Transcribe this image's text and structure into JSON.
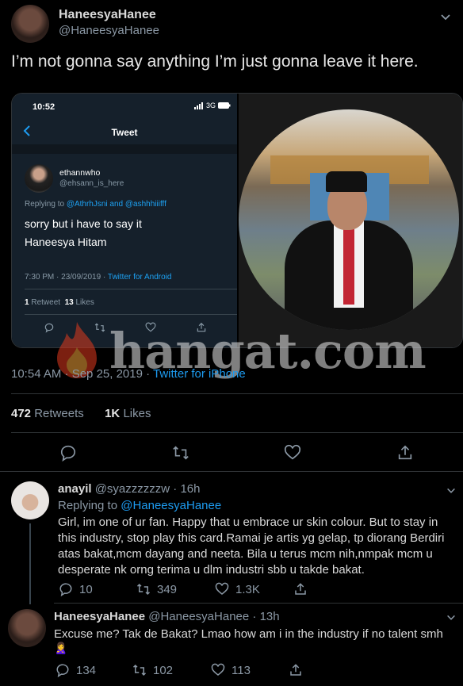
{
  "main_tweet": {
    "display_name": "HaneesyaHanee",
    "handle": "@HaneesyaHanee",
    "text": "I’m not gonna say anything I’m just gonna leave it here.",
    "timestamp": "10:54 AM · Sep 25, 2019 · ",
    "source": "Twitter for iPhone",
    "retweets_count": "472",
    "retweets_label": "Retweets",
    "likes_count": "1K",
    "likes_label": "Likes"
  },
  "embedded_screenshot": {
    "status_time": "10:52",
    "network": "3G",
    "nav_title": "Tweet",
    "author_name": "ethannwho",
    "author_handle": "@ehsann_is_here",
    "replying_prefix": "Replying to ",
    "replying_to": "@AthrhJsni and @ashhhiiifff",
    "text_line1": "sorry but i have to say it",
    "text_line2": "Haneesya Hitam",
    "meta_time": "7:30 PM · 23/09/2019 · ",
    "meta_source": "Twitter for Android",
    "retweets_count": "1",
    "retweets_label": "Retweet",
    "likes_count": "13",
    "likes_label": "Likes"
  },
  "watermark": "hangat.com",
  "reply1": {
    "display_name": "anayil",
    "handle": "@syazzzzzzw",
    "time": " · 16h",
    "replying_prefix": "Replying to ",
    "replying_to": "@HaneesyaHanee",
    "text": "Girl, im one of ur fan. Happy that u embrace ur skin colour. But to stay in this industry, stop play this card.Ramai je artis yg gelap, tp diorang Berdiri atas bakat,mcm dayang and neeta. Bila u terus mcm nih,nmpak mcm u desperate nk orng terima u dlm industri sbb u takde bakat.",
    "replies": "10",
    "retweets": "349",
    "likes": "1.3K"
  },
  "reply2": {
    "display_name": "HaneesyaHanee",
    "handle": "@HaneesyaHanee",
    "time": " · 13h",
    "text": "Excuse me? Tak de Bakat? Lmao how am i in the industry if no talent smh",
    "emoji": "🙎‍♀️",
    "replies": "134",
    "retweets": "102",
    "likes": "113"
  },
  "colors": {
    "background": "#000000",
    "link": "#1d9bf0",
    "muted": "#8b98a5",
    "watermark": "#e03a1e"
  }
}
